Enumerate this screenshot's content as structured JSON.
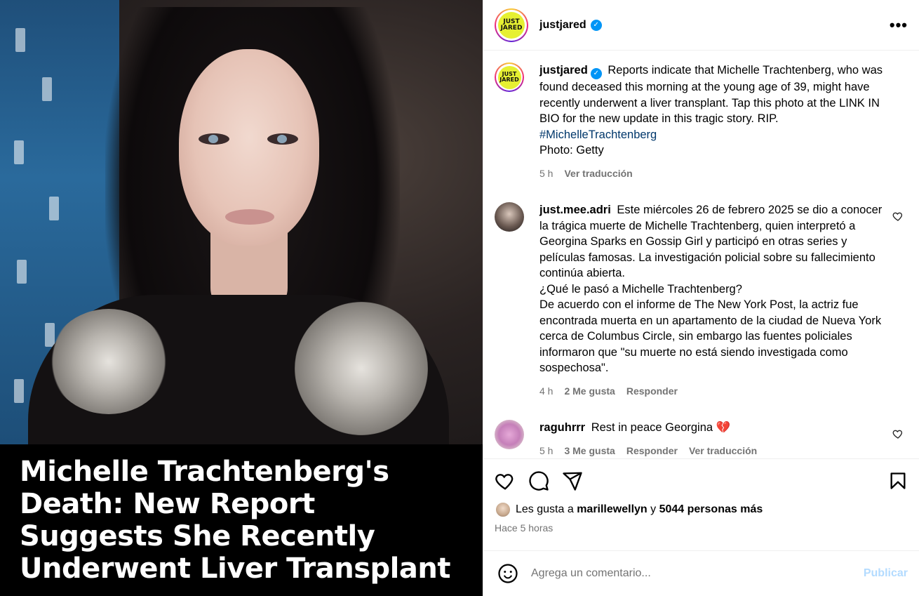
{
  "post": {
    "image_caption": "Michelle Trachtenberg's Death: New Report Suggests She Recently Underwent Liver Transplant"
  },
  "header": {
    "avatar_text": "JUST JARED",
    "username": "justjared",
    "more_label": "•••"
  },
  "caption": {
    "username": "justjared",
    "text": "Reports indicate that Michelle Trachtenberg, who was found deceased this morning at the young age of 39, might have recently underwent a liver transplant. Tap this photo at the LINK IN BIO for the new update in this tragic story. RIP.",
    "hashtag": "#MichelleTrachtenberg",
    "credit": "Photo: Getty",
    "time": "5 h",
    "translate": "Ver traducción"
  },
  "comments": [
    {
      "username": "just.mee.adri",
      "lines": [
        "Este miércoles 26 de febrero 2025 se dio a conocer la trágica muerte de Michelle Trachtenberg, quien interpretó a Georgina Sparks en Gossip Girl y participó en otras series y películas famosas. La investigación policial sobre su fallecimiento continúa abierta.",
        "¿Qué le pasó a Michelle Trachtenberg?",
        "De acuerdo con el informe de The New York Post, la actriz fue encontrada muerta en un apartamento de la ciudad de Nueva York cerca de Columbus Circle, sin embargo las fuentes policiales informaron que \"su muerte no está siendo investigada como sospechosa\"."
      ],
      "time": "4 h",
      "likes": "2 Me gusta",
      "reply": "Responder"
    },
    {
      "username": "raguhrrr",
      "text": "Rest in peace Georgina",
      "emoji": "💔",
      "time": "5 h",
      "likes": "3 Me gusta",
      "reply": "Responder",
      "translate": "Ver traducción"
    }
  ],
  "likes_line": {
    "prefix": "Les gusta a",
    "user": "marillewellyn",
    "conj": "y",
    "others": "5044 personas más"
  },
  "posted_ago": "Hace 5 horas",
  "add_comment": {
    "placeholder": "Agrega un comentario...",
    "publish": "Publicar"
  },
  "colors": {
    "verified": "#0095f6",
    "hashtag": "#00376b",
    "muted": "#737373",
    "publish_disabled": "#b3dbff"
  }
}
